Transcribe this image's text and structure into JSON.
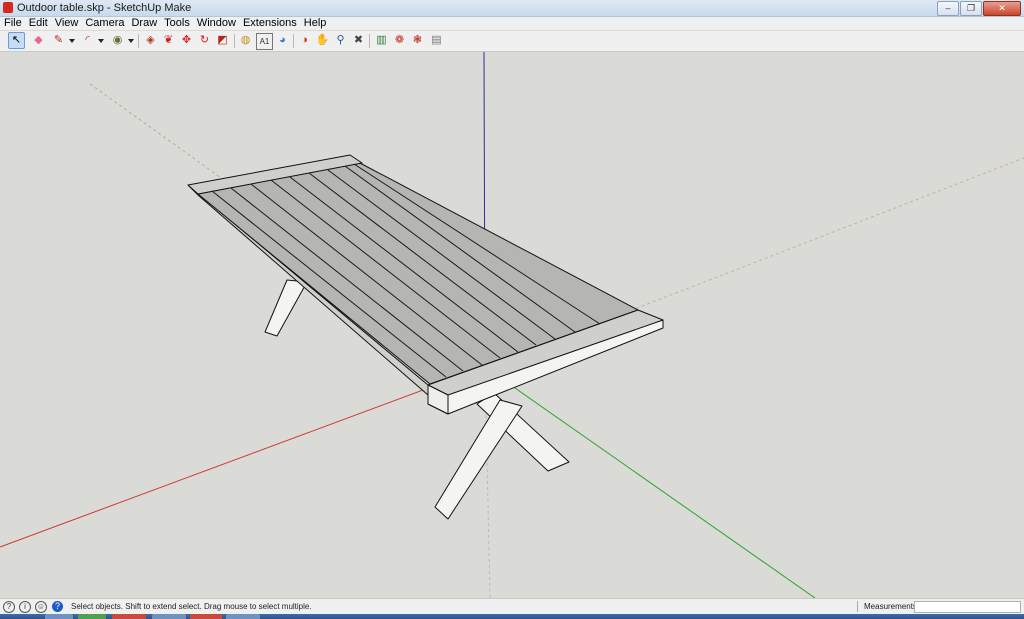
{
  "window": {
    "title": "Outdoor table.skp - SketchUp Make",
    "controls": [
      "–",
      "❐",
      "✕"
    ]
  },
  "menu": [
    "File",
    "Edit",
    "View",
    "Camera",
    "Draw",
    "Tools",
    "Window",
    "Extensions",
    "Help"
  ],
  "toolbar": {
    "tools": [
      {
        "name": "select",
        "glyph": "↖",
        "color": "#000000",
        "selected": true
      },
      {
        "name": "eraser",
        "glyph": "◆",
        "color": "#e46b8c"
      },
      {
        "name": "line",
        "glyph": "✎",
        "color": "#c0231a"
      },
      {
        "name": "arc",
        "glyph": "◜",
        "color": "#c0231a"
      },
      {
        "name": "shapes",
        "glyph": "◉",
        "color": "#6d6d3a"
      },
      {
        "name": "push-pull",
        "glyph": "◈",
        "color": "#b03a22"
      },
      {
        "name": "follow-me",
        "glyph": "❦",
        "color": "#cc2222"
      },
      {
        "name": "move",
        "glyph": "✥",
        "color": "#d42020"
      },
      {
        "name": "rotate",
        "glyph": "↻",
        "color": "#d42020"
      },
      {
        "name": "scale",
        "glyph": "◩",
        "color": "#b3261e"
      },
      {
        "name": "tape-measure",
        "glyph": "◍",
        "color": "#c88f15"
      },
      {
        "name": "text",
        "glyph": "A1",
        "color": "#333333"
      },
      {
        "name": "paint-bucket",
        "glyph": "◕",
        "color": "#3f7fc8"
      },
      {
        "name": "orbit",
        "glyph": "◑",
        "color": "#c83218"
      },
      {
        "name": "pan",
        "glyph": "✋",
        "color": "#444444"
      },
      {
        "name": "zoom",
        "glyph": "⚲",
        "color": "#235aa6"
      },
      {
        "name": "zoom-extents",
        "glyph": "✖",
        "color": "#444444"
      },
      {
        "name": "3d-warehouse",
        "glyph": "▥",
        "color": "#2d7a3a"
      },
      {
        "name": "extension-warehouse",
        "glyph": "❁",
        "color": "#c23522"
      },
      {
        "name": "components",
        "glyph": "❃",
        "color": "#c23522"
      },
      {
        "name": "layout",
        "glyph": "▤",
        "color": "#777777"
      }
    ]
  },
  "status": {
    "icons": [
      "?",
      "i",
      "☺"
    ],
    "help_icon": "?",
    "message": "Select objects. Shift to extend select. Drag mouse to select multiple.",
    "measurements_label": "Measurements",
    "measurements_value": ""
  },
  "colors": {
    "background": "#dadad6",
    "axis_red": "#d0352e",
    "axis_green": "#2aa52a",
    "axis_blue": "#2d2fa6",
    "top_slats": "#b5b5b2",
    "end_caps": "#cfcfcc",
    "legs": "#f4f4f2",
    "edges": "#111111"
  }
}
